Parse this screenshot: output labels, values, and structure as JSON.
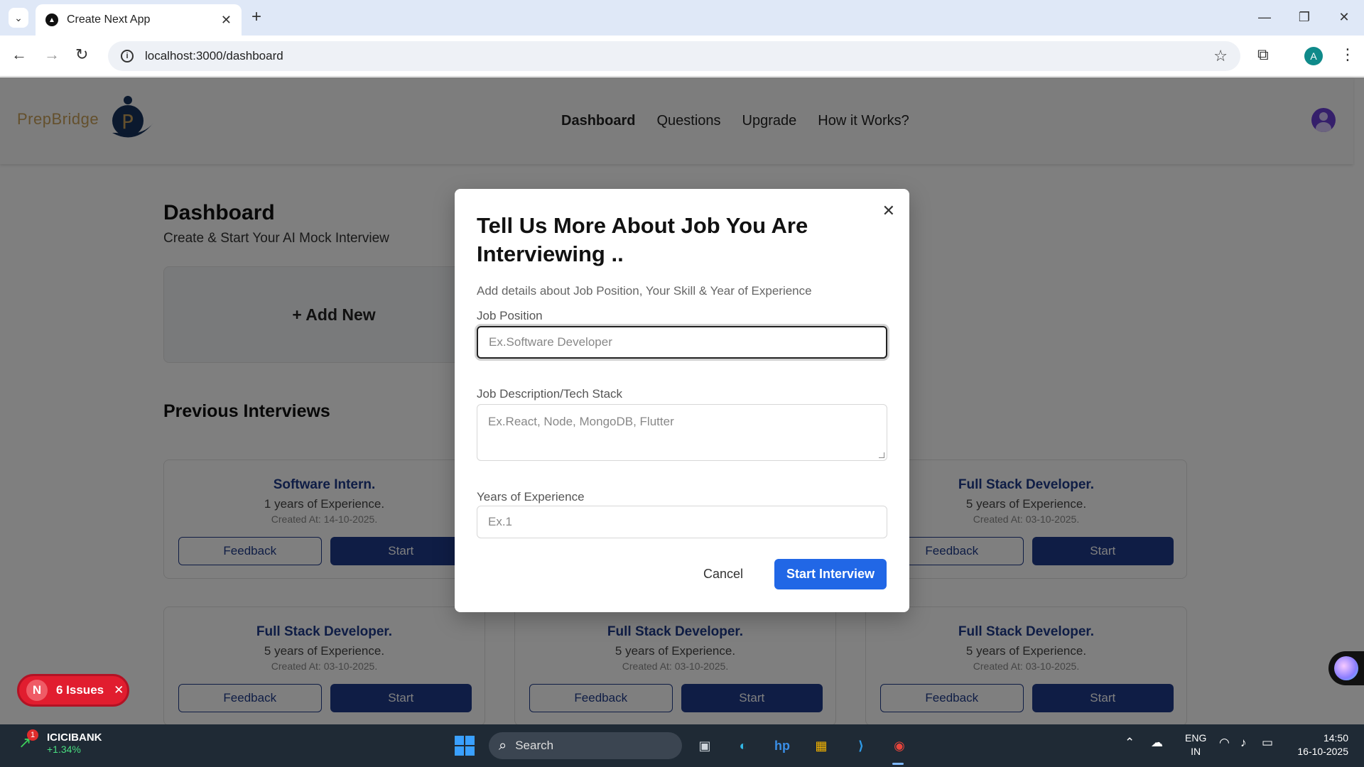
{
  "browser": {
    "tab_title": "Create Next App",
    "url": "localhost:3000/dashboard",
    "profile_initial": "A"
  },
  "app": {
    "brand": "PrepBridge",
    "logo_letter": "P",
    "nav": [
      "Dashboard",
      "Questions",
      "Upgrade",
      "How it Works?"
    ]
  },
  "dashboard": {
    "title": "Dashboard",
    "subtitle": "Create & Start Your AI Mock Interview",
    "add_new": "+ Add New",
    "previous_title": "Previous Interviews",
    "feedback_label": "Feedback",
    "start_label": "Start",
    "interviews": [
      {
        "role": "Software Intern.",
        "experience": "1 years of Experience.",
        "created": "Created At: 14-10-2025."
      },
      {
        "role": "Full Stack Developer.",
        "experience": "5 years of Experience.",
        "created": "Created At: 03-10-2025."
      },
      {
        "role": "Full Stack Developer.",
        "experience": "5 years of Experience.",
        "created": "Created At: 03-10-2025."
      },
      {
        "role": "Full Stack Developer.",
        "experience": "5 years of Experience.",
        "created": "Created At: 03-10-2025."
      },
      {
        "role": "Full Stack Developer.",
        "experience": "5 years of Experience.",
        "created": "Created At: 03-10-2025."
      }
    ]
  },
  "dialog": {
    "title": "Tell Us More About Job You Are Interviewing ..",
    "description": "Add details about Job Position, Your Skill & Year of Experience",
    "job_position_label": "Job Position",
    "job_position_placeholder": "Ex.Software Developer",
    "job_desc_label": "Job Description/Tech Stack",
    "job_desc_placeholder": "Ex.React, Node, MongoDB, Flutter",
    "years_label": "Years of Experience",
    "years_placeholder": "Ex.1",
    "cancel": "Cancel",
    "start": "Start Interview"
  },
  "dev_overlay": {
    "badge": "N",
    "issues": "6 Issues"
  },
  "taskbar": {
    "stock_name": "ICICIBANK",
    "stock_change": "+1.34%",
    "notification_count": "1",
    "search": "Search",
    "lang_top": "ENG",
    "lang_bottom": "IN",
    "time": "14:50",
    "date": "16-10-2025"
  },
  "colors": {
    "primary_navy": "#1e3a8a",
    "start_interview_blue": "#2167e6",
    "issues_red": "#e11d2f",
    "brand_gold": "#c8a15a"
  }
}
